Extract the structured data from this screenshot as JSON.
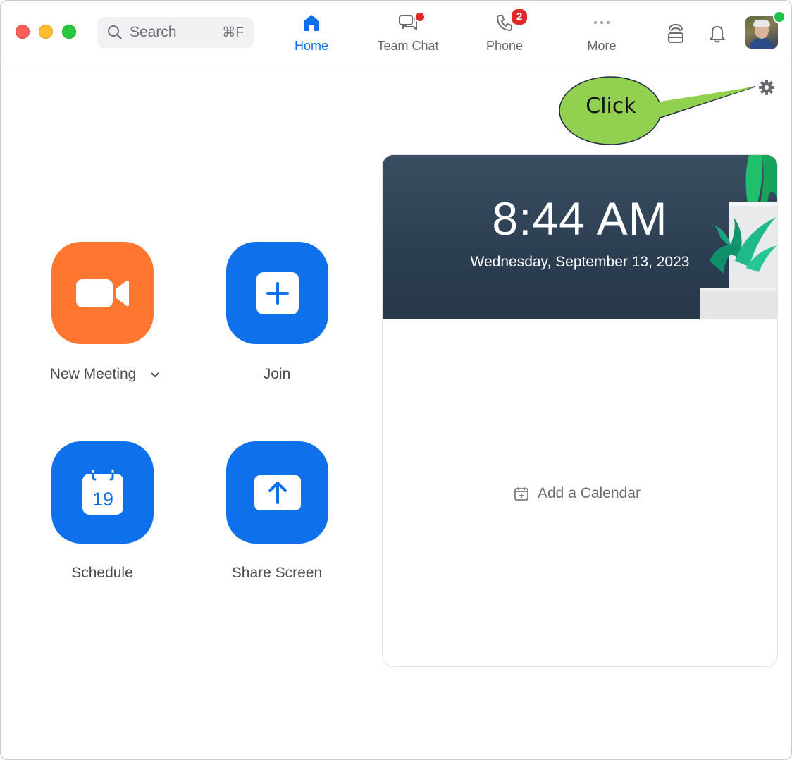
{
  "search": {
    "label": "Search",
    "shortcut": "⌘F"
  },
  "nav": {
    "tabs": [
      {
        "label": "Home",
        "icon": "home-icon",
        "active": true
      },
      {
        "label": "Team Chat",
        "icon": "chat-icon",
        "badge": "dot"
      },
      {
        "label": "Phone",
        "icon": "phone-icon",
        "badge": "2"
      },
      {
        "label": "More",
        "icon": "more-icon"
      }
    ]
  },
  "header_icons": [
    "whiteboard-icon",
    "bell-icon",
    "avatar"
  ],
  "callout": {
    "text": "Click"
  },
  "actions": {
    "new_meeting": "New Meeting",
    "join": "Join",
    "schedule": "Schedule",
    "schedule_day": "19",
    "share_screen": "Share Screen"
  },
  "calendar": {
    "time": "8:44 AM",
    "date": "Wednesday, September 13, 2023",
    "add_calendar": "Add a Calendar"
  },
  "colors": {
    "accent": "#0e71eb",
    "new_meeting": "#fe7630",
    "badge": "#e02828",
    "online": "#1ec24b",
    "callout": "#92d050"
  }
}
